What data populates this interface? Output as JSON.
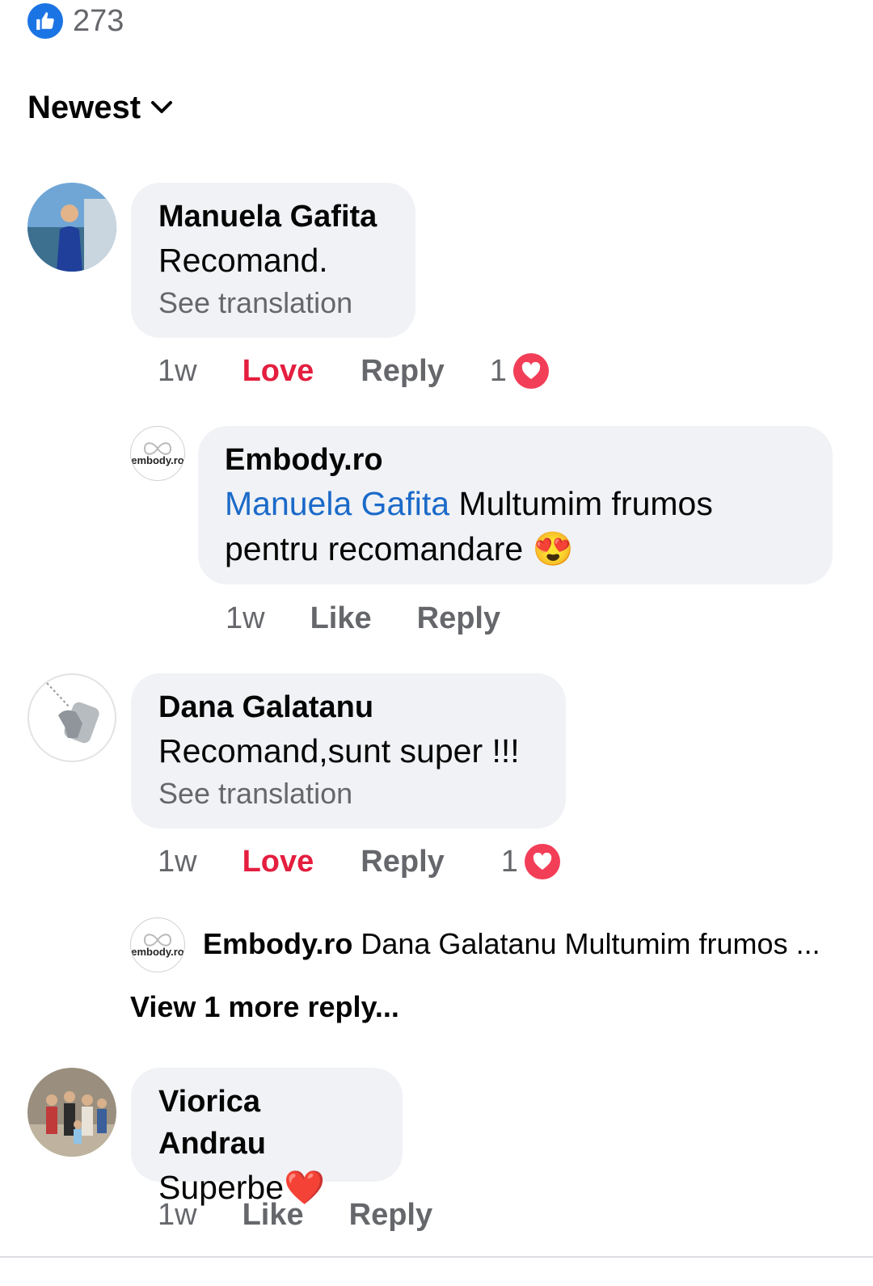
{
  "reactions": {
    "count": "273",
    "icon": "thumbs-up-icon"
  },
  "sort": {
    "label": "Newest",
    "icon": "chevron-down-icon"
  },
  "comments": [
    {
      "author": "Manuela Gafita",
      "text": "Recomand.",
      "see_translation": "See translation",
      "time": "1w",
      "action_reaction": "Love",
      "action_reply": "Reply",
      "reaction_count": "1",
      "reaction_icon": "heart-icon",
      "replies": [
        {
          "author": "Embody.ro",
          "avatar_label": "embody.ro",
          "mention": "Manuela Gafita",
          "text": " Multumim frumos pentru recomandare ",
          "emoji": "😍",
          "time": "1w",
          "action_like": "Like",
          "action_reply": "Reply"
        }
      ]
    },
    {
      "author": "Dana Galatanu",
      "text": "Recomand,sunt super !!!",
      "see_translation": "See translation",
      "time": "1w",
      "action_reaction": "Love",
      "action_reply": "Reply",
      "reaction_count": "1",
      "reaction_icon": "heart-icon",
      "reply_preview": {
        "author": "Embody.ro",
        "avatar_label": "embody.ro",
        "text": "Dana Galatanu Multumim frumos ..."
      },
      "view_more": "View 1 more reply..."
    },
    {
      "author": "Viorica Andrau",
      "text": "Superbe",
      "emoji": "❤️",
      "time": "1w",
      "action_like": "Like",
      "action_reply": "Reply"
    }
  ],
  "colors": {
    "accent_blue": "#1b74e4",
    "love_red": "#e41e3f",
    "bubble_bg": "#f0f2f5",
    "muted_text": "#65676b"
  }
}
